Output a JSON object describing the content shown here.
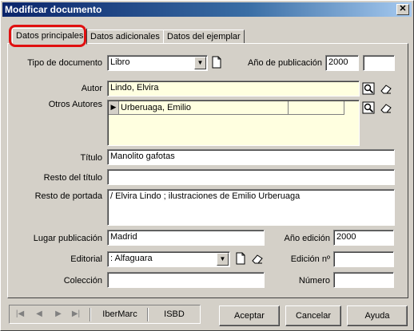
{
  "window": {
    "title": "Modificar documento"
  },
  "tabs": [
    {
      "label": "Datos principales"
    },
    {
      "label": "Datos adicionales"
    },
    {
      "label": "Datos del ejemplar"
    }
  ],
  "form": {
    "tipo_documento": {
      "label": "Tipo de documento",
      "value": "Libro"
    },
    "anio_publicacion": {
      "label": "Año de publicación",
      "value": "2000",
      "value2": ""
    },
    "autor": {
      "label": "Autor",
      "value": "Lindo, Elvira"
    },
    "otros_autores": {
      "label": "Otros Autores",
      "rows": [
        {
          "name": "Urberuaga, Emilio"
        }
      ]
    },
    "titulo": {
      "label": "Título",
      "value": "Manolito gafotas"
    },
    "resto_titulo": {
      "label": "Resto del título",
      "value": ""
    },
    "resto_portada": {
      "label": "Resto de portada",
      "value": "/ Elvira Lindo ; ilustraciones de Emilio Urberuaga"
    },
    "lugar_publicacion": {
      "label": "Lugar publicación",
      "value": "Madrid"
    },
    "anio_edicion": {
      "label": "Año edición",
      "value": "2000"
    },
    "editorial": {
      "label": "Editorial",
      "value": ": Alfaguara"
    },
    "edicion_no": {
      "label": "Edición nº",
      "value": ""
    },
    "coleccion": {
      "label": "Colección",
      "value": ""
    },
    "numero": {
      "label": "Número",
      "value": ""
    }
  },
  "bottom": {
    "ibermarc": "IberMarc",
    "isbd": "ISBD",
    "aceptar": "Aceptar",
    "cancelar": "Cancelar",
    "ayuda": "Ayuda"
  },
  "icons": {
    "nav": [
      "first-icon",
      "prev-icon",
      "next-icon",
      "last-icon"
    ],
    "search": "search-icon",
    "eraser": "eraser-icon",
    "document": "document-icon"
  }
}
